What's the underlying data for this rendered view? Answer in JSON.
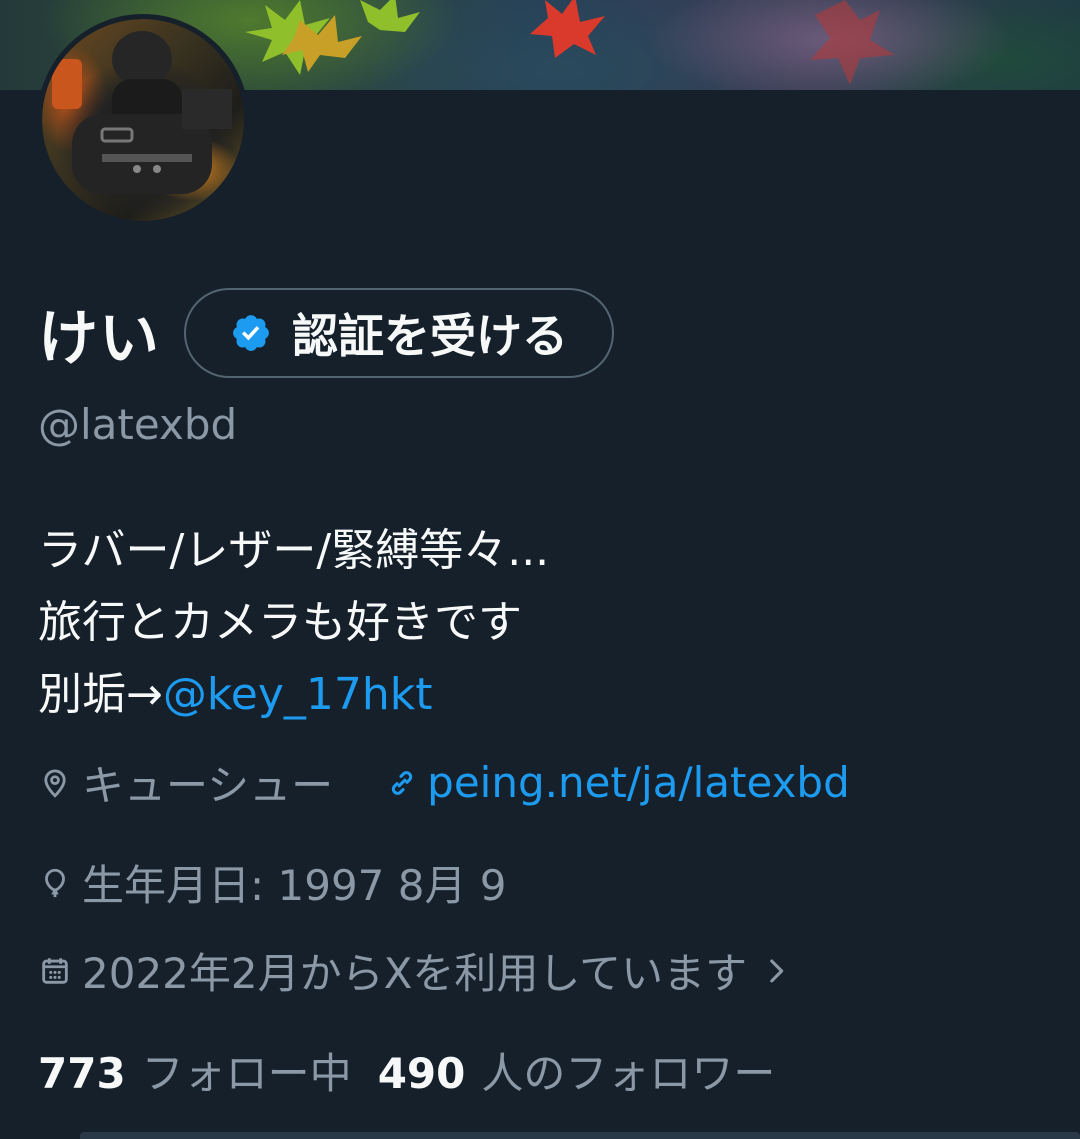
{
  "profile": {
    "display_name": "けい",
    "verify_button_label": "認証を受ける",
    "handle": "@latexbd",
    "bio": {
      "line1": "ラバー/レザー/緊縛等々...",
      "line2": "旅行とカメラも好きです",
      "line3_prefix": "別垢→",
      "line3_mention": "@key_17hkt"
    },
    "location": "キューシュー",
    "website": "peing.net/ja/latexbd",
    "birthday": "生年月日: 1997 8月 9",
    "joined": "2022年2月からXを利用しています",
    "following_count": "773",
    "following_label": "フォロー中",
    "followers_count": "490",
    "followers_label": "人のフォロワー"
  },
  "icons": {
    "verify": "verified-badge-icon",
    "location": "location-pin-icon",
    "website": "link-icon",
    "birthday": "balloon-icon",
    "joined": "calendar-icon",
    "joined_more": "chevron-right-icon"
  },
  "colors": {
    "background": "#15202b",
    "text_primary": "#f7f9f9",
    "text_secondary": "#8b98a5",
    "accent": "#1d9bf0"
  }
}
